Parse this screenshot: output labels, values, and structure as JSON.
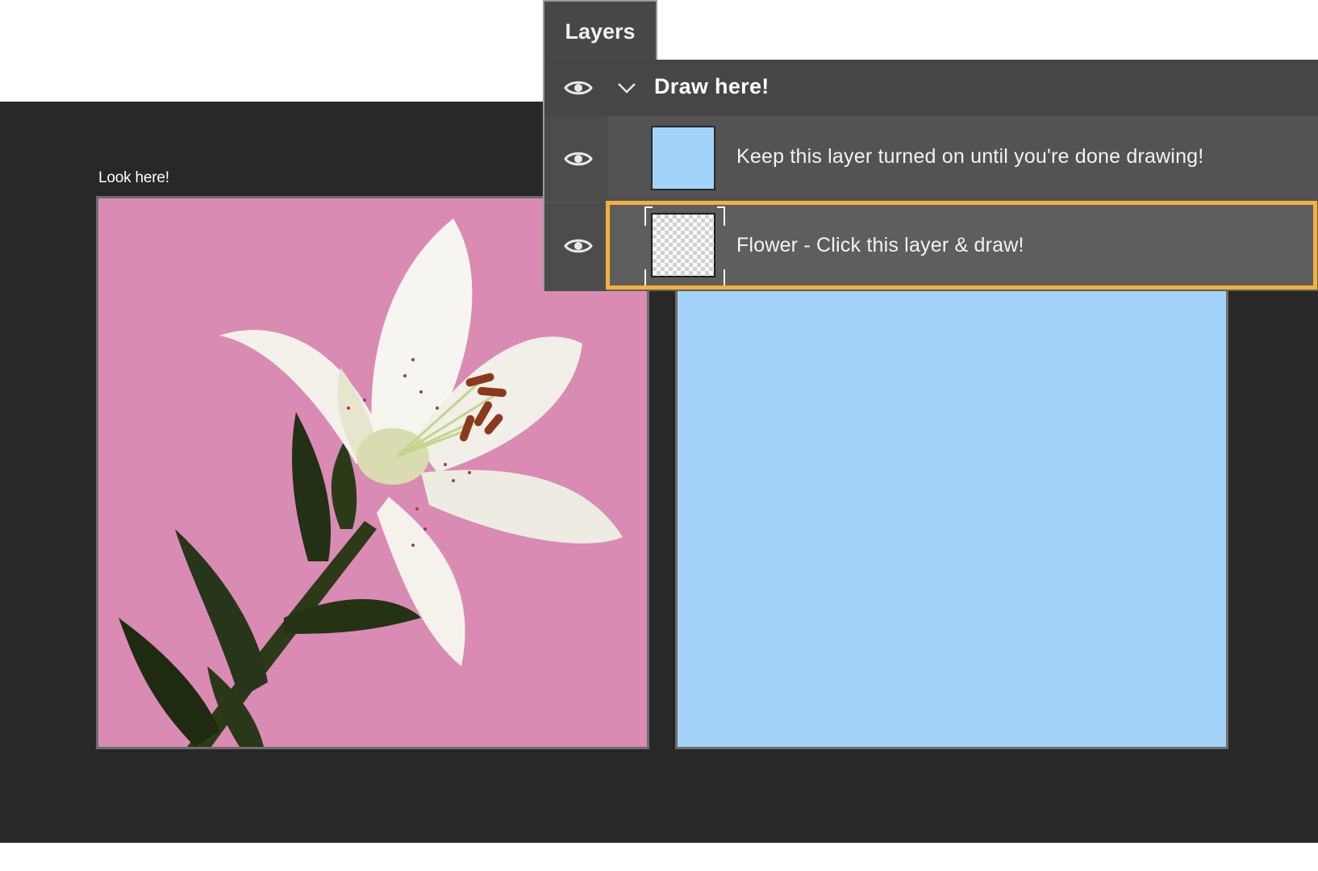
{
  "canvas": {
    "label": "Look here!",
    "left_background": "#d98bb3",
    "right_background": "#a3d3f9",
    "workspace_color": "#282828"
  },
  "layers_panel": {
    "tab_title": "Layers",
    "group": {
      "name": "Draw here!",
      "expanded": true,
      "visible": true,
      "icons": [
        "eye-icon",
        "chevron-down-icon"
      ]
    },
    "layers": [
      {
        "name": "Keep this layer turned on until you're done drawing!",
        "visible": true,
        "thumbnail": "solid-blue",
        "thumbnail_color": "#a3d3f9",
        "selected": false
      },
      {
        "name": "Flower - Click this layer & draw!",
        "visible": true,
        "thumbnail": "transparent-checkerboard",
        "selected": true
      }
    ],
    "highlight_color": "#f2b13b"
  }
}
